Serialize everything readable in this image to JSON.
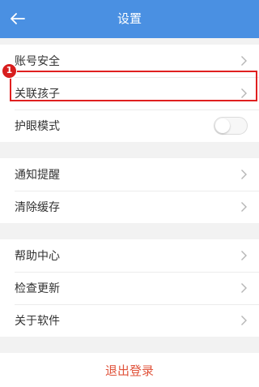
{
  "header": {
    "title": "设置",
    "back_icon": "arrow-left-icon"
  },
  "groups": [
    {
      "items": [
        {
          "label": "账号安全",
          "icon": "chevron-right-icon"
        },
        {
          "label": "关联孩子",
          "icon": "chevron-right-icon",
          "highlighted": true
        },
        {
          "label": "护眼模式",
          "control": "toggle",
          "toggle_on": false
        }
      ]
    },
    {
      "items": [
        {
          "label": "通知提醒",
          "icon": "chevron-right-icon"
        },
        {
          "label": "清除缓存",
          "icon": "chevron-right-icon"
        }
      ]
    },
    {
      "items": [
        {
          "label": "帮助中心",
          "icon": "chevron-right-icon"
        },
        {
          "label": "检查更新",
          "icon": "chevron-right-icon"
        },
        {
          "label": "关于软件",
          "icon": "chevron-right-icon"
        }
      ]
    }
  ],
  "annotation": {
    "step_number": "1",
    "color": "#e02020"
  },
  "logout": {
    "label": "退出登录",
    "color": "#e0533b"
  },
  "colors": {
    "header_bg": "#4a90e2",
    "page_bg": "#f2f2f2"
  }
}
